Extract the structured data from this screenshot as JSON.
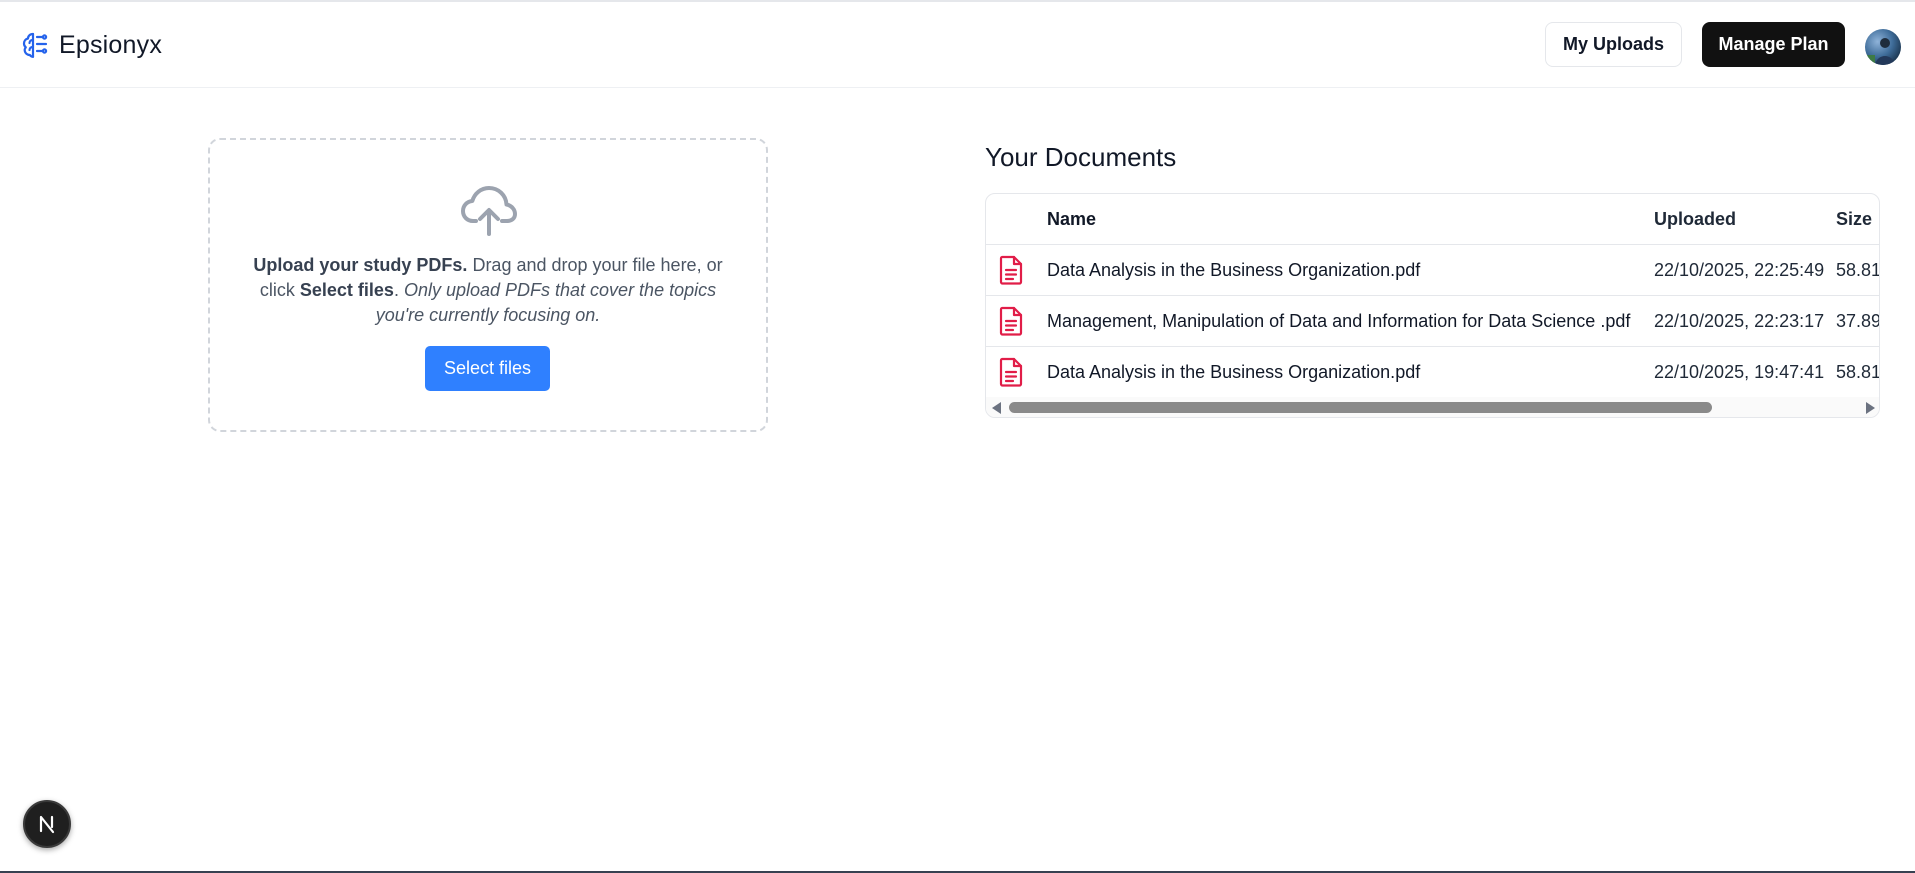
{
  "app": {
    "brand_name": "Epsionyx",
    "brand_color": "#2563eb"
  },
  "header": {
    "my_uploads_label": "My Uploads",
    "manage_plan_label": "Manage Plan",
    "avatar_alt": "User avatar"
  },
  "upload": {
    "bold_lead": "Upload your study PDFs.",
    "text_1": " Drag and drop your file here, or click ",
    "bold_select": "Select files",
    "text_2": ". ",
    "italic_note": "Only upload PDFs that cover the topics you're currently focusing on.",
    "button_label": "Select files",
    "button_color": "#2f80ff",
    "icon": "cloud-upload-icon"
  },
  "documents": {
    "title": "Your Documents",
    "columns": [
      "Name",
      "Uploaded",
      "Size"
    ],
    "rows": [
      {
        "name": "Data Analysis in the Business Organization.pdf",
        "uploaded": "22/10/2025, 22:25:49",
        "size": "58.81"
      },
      {
        "name": "Management, Manipulation of Data and Information for Data Science .pdf",
        "uploaded": "22/10/2025, 22:23:17",
        "size": "37.89"
      },
      {
        "name": "Data Analysis in the Business Organization.pdf",
        "uploaded": "22/10/2025, 19:47:41",
        "size": "58.81"
      }
    ],
    "file_icon": "pdf-file-icon",
    "file_icon_color": "#e11d48"
  },
  "dev_badge": {
    "letter": "N",
    "icon": "nextjs-icon"
  }
}
